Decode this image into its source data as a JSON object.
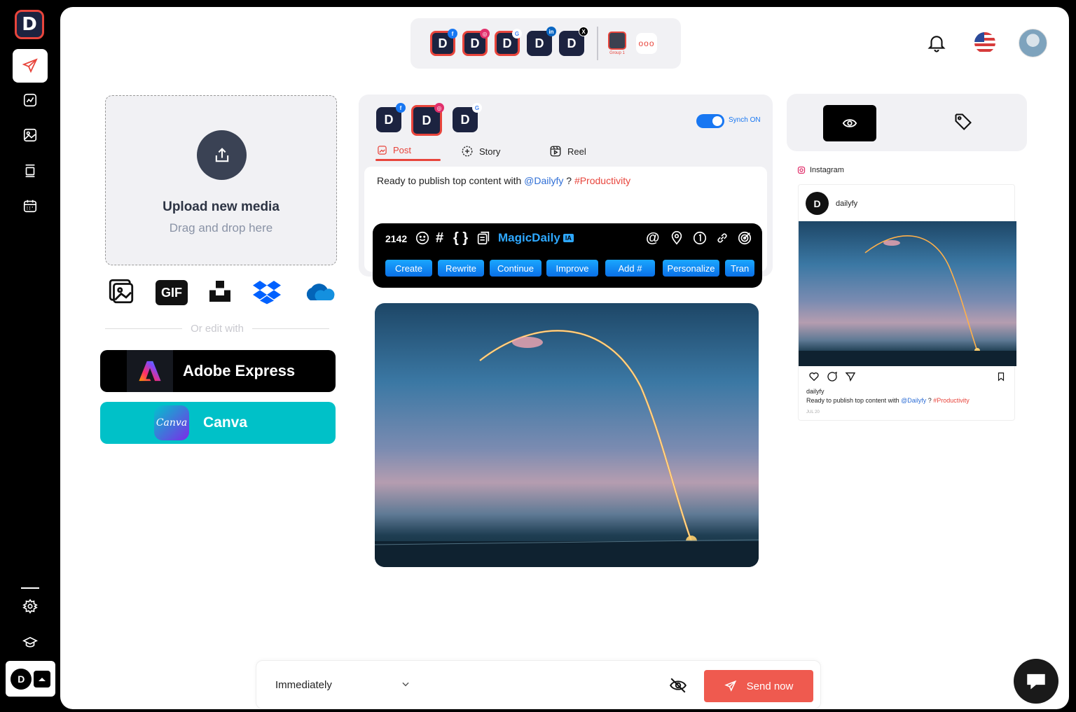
{
  "app": {
    "logo_letter": "D",
    "accent": "#e8453c",
    "brand_blue": "#1877f2"
  },
  "rail": {
    "items": [
      {
        "icon": "paper-plane-icon",
        "active": true
      },
      {
        "icon": "analytics-icon",
        "active": false
      },
      {
        "icon": "media-library-icon",
        "active": false
      },
      {
        "icon": "posts-list-icon",
        "active": false
      },
      {
        "icon": "calendar-icon",
        "active": false
      }
    ],
    "bottom_items": [
      {
        "icon": "gear-icon"
      },
      {
        "icon": "graduation-cap-icon"
      }
    ],
    "workspace_letter": "D"
  },
  "channels": {
    "accounts": [
      {
        "letter": "D",
        "network": "facebook",
        "badge": "f"
      },
      {
        "letter": "D",
        "network": "instagram",
        "badge": "◎"
      },
      {
        "letter": "D",
        "network": "google",
        "badge": "G"
      },
      {
        "letter": "D",
        "network": "linkedin",
        "badge": "in"
      },
      {
        "letter": "D",
        "network": "x",
        "badge": "X"
      }
    ],
    "group_label": "Group 1",
    "more_label": "ooo"
  },
  "upload": {
    "title": "Upload new media",
    "subtitle": "Drag and drop here",
    "gif_label": "GIF",
    "or_edit": "Or edit with",
    "adobe_label": "Adobe Express",
    "canva_label": "Canva",
    "canva_logo": "Canva"
  },
  "editor": {
    "selected_channels": [
      {
        "letter": "D",
        "network": "facebook",
        "badge": "f"
      },
      {
        "letter": "D",
        "network": "instagram",
        "badge": "◎"
      },
      {
        "letter": "D",
        "network": "google",
        "badge": "G"
      }
    ],
    "sync_label": "Synch ON",
    "tabs": [
      {
        "label": "Post",
        "active": true
      },
      {
        "label": "Story",
        "active": false
      },
      {
        "label": "Reel",
        "active": false
      }
    ],
    "text_prefix": "Ready to publish top content with ",
    "mention": "@Dailyfy",
    "text_middle": " ? ",
    "hashtag": "#Productivity"
  },
  "toolbar": {
    "char_count": "2142",
    "magic_label": "MagicDaily",
    "magic_badge": "IA",
    "sym_hash": "#",
    "sym_braces": "{ }",
    "sym_at": "@",
    "actions": [
      "Create",
      "Rewrite",
      "Continue",
      "Improve",
      "Add #",
      "Personalize",
      "Tran"
    ]
  },
  "preview": {
    "network_label": "Instagram",
    "account_name": "dailyfy",
    "user": "dailyfy",
    "caption_prefix": "Ready to publish top content with ",
    "mention": "@Dailyfy",
    "caption_middle": " ? ",
    "hashtag": "#Productivity",
    "date": "JUL 20"
  },
  "bottom_bar": {
    "schedule_value": "Immediately",
    "send_label": "Send now"
  }
}
